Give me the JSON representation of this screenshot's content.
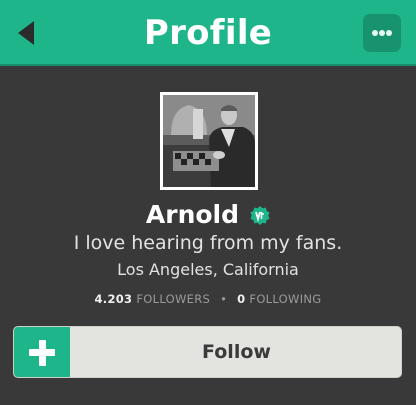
{
  "header": {
    "title": "Profile",
    "back_icon": "back-arrow-icon",
    "more_icon": "more-options-icon"
  },
  "profile": {
    "name": "Arnold",
    "verified_icon": "verified-badge-icon",
    "bio": "I love hearing from my fans.",
    "location": "Los Angeles, California",
    "followers_count": "4.203",
    "followers_label": "FOLLOWERS",
    "stats_separator": "•",
    "following_count": "0",
    "following_label": "FOLLOWING"
  },
  "follow_button": {
    "label": "Follow",
    "icon": "plus-icon"
  },
  "colors": {
    "accent": "#1fb58a",
    "accent_dark": "#17946f",
    "background": "#393939",
    "button_bg": "#e3e3e0"
  }
}
